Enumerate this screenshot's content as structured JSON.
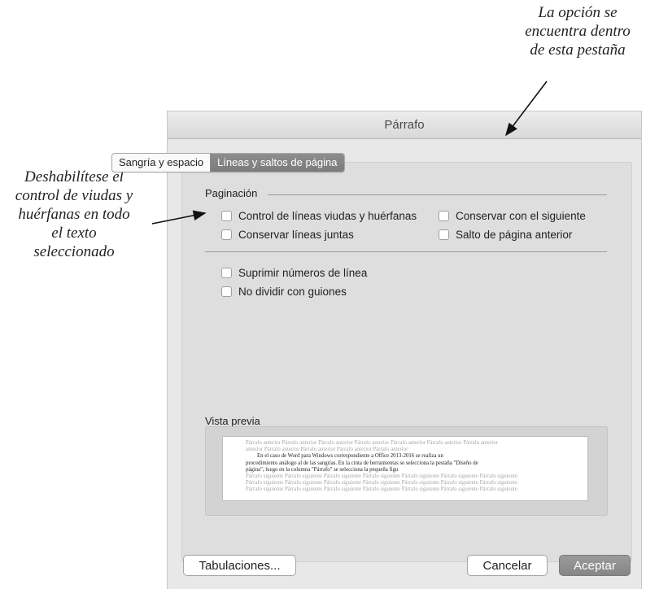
{
  "annotations": {
    "top": [
      "La opción se",
      "encuentra dentro",
      "de esta pestaña"
    ],
    "left": [
      "Deshabilítese el",
      "control de viudas y",
      "huérfanas en todo",
      "el texto",
      "seleccionado"
    ]
  },
  "dialog": {
    "title": "Párrafo",
    "tabs": [
      {
        "label": "Sangría y espacio",
        "active": false
      },
      {
        "label": "Líneas y saltos de página",
        "active": true
      }
    ],
    "pagination": {
      "label": "Paginación",
      "options": [
        {
          "label": "Control de líneas viudas y huérfanas",
          "checked": false
        },
        {
          "label": "Conservar con el siguiente",
          "checked": false
        },
        {
          "label": "Conservar líneas juntas",
          "checked": false
        },
        {
          "label": "Salto de página anterior",
          "checked": false
        }
      ]
    },
    "extra_options": [
      {
        "label": "Suprimir números de línea",
        "checked": false
      },
      {
        "label": "No dividir con guiones",
        "checked": false
      }
    ],
    "preview": {
      "label": "Vista previa",
      "before_lines": [
        "Párrafo anterior Párrafo anterior Párrafo anterior Párrafo anterior Párrafo anterior Párrafo anterior Párrafo anterior",
        "anterior Párrafo anterior Párrafo anterior Párrafo anterior Párrafo anterior"
      ],
      "body_lines": [
        "En el caso de Word para Windows correspondiente a Office 2013-2016 se realiza un",
        "procedimiento análogo al de las sangrías. En la cinta de herramientas se selecciona la pestaña \"Diseño de",
        "página\", luego en la columna \"Párrafo\" se selecciona la pequeña figu"
      ],
      "after_lines": [
        "Párrafo siguiente Párrafo siguiente Párrafo siguiente Párrafo siguiente Párrafo siguiente Párrafo siguiente Párrafo siguiente",
        "Párrafo siguiente Párrafo siguiente Párrafo siguiente Párrafo siguiente Párrafo siguiente Párrafo siguiente Párrafo siguiente",
        "Párrafo siguiente Párrafo siguiente Párrafo siguiente Párrafo siguiente Párrafo siguiente Párrafo siguiente Párrafo siguiente"
      ]
    },
    "buttons": {
      "tabs_label": "Tabulaciones...",
      "cancel_label": "Cancelar",
      "accept_label": "Aceptar"
    }
  }
}
